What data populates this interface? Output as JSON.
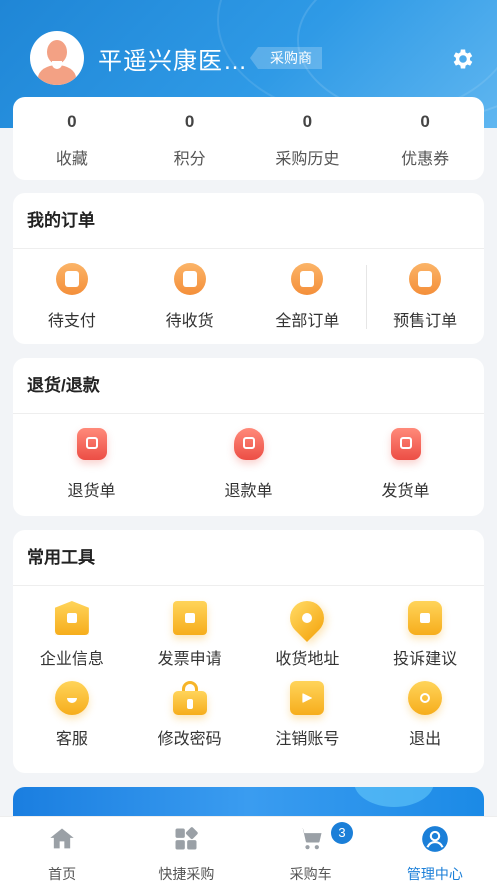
{
  "header": {
    "username": "平遥兴康医…",
    "role": "采购商"
  },
  "stats": [
    {
      "value": "0",
      "label": "收藏"
    },
    {
      "value": "0",
      "label": "积分"
    },
    {
      "value": "0",
      "label": "采购历史"
    },
    {
      "value": "0",
      "label": "优惠券"
    }
  ],
  "orders": {
    "title": "我的订单",
    "items": [
      {
        "label": "待支付",
        "icon": "wallet-icon"
      },
      {
        "label": "待收货",
        "icon": "package-icon"
      },
      {
        "label": "全部订单",
        "icon": "document-icon"
      },
      {
        "label": "预售订单",
        "icon": "calendar-clock-icon"
      }
    ]
  },
  "refunds": {
    "title": "退货/退款",
    "items": [
      {
        "label": "退货单",
        "icon": "return-icon"
      },
      {
        "label": "退款单",
        "icon": "money-bag-icon"
      },
      {
        "label": "发货单",
        "icon": "clipboard-edit-icon"
      }
    ]
  },
  "tools": {
    "title": "常用工具",
    "items": [
      {
        "label": "企业信息",
        "icon": "store-icon"
      },
      {
        "label": "发票申请",
        "icon": "receipt-icon"
      },
      {
        "label": "收货地址",
        "icon": "location-pin-icon"
      },
      {
        "label": "投诉建议",
        "icon": "chat-bubble-icon"
      },
      {
        "label": "客服",
        "icon": "smile-chat-icon"
      },
      {
        "label": "修改密码",
        "icon": "lock-icon"
      },
      {
        "label": "注销账号",
        "icon": "exit-door-icon"
      },
      {
        "label": "退出",
        "icon": "power-icon"
      }
    ]
  },
  "tabbar": {
    "items": [
      {
        "label": "首页",
        "icon": "home-icon"
      },
      {
        "label": "快捷采购",
        "icon": "grid-icon"
      },
      {
        "label": "采购车",
        "icon": "cart-icon"
      },
      {
        "label": "管理中心",
        "icon": "user-circle-icon"
      }
    ],
    "cart_count": "3",
    "active_index": 3
  },
  "colors": {
    "accent": "#1b7fd8",
    "order_icon": "#f48f3a",
    "refund_icon": "#ec4e45",
    "tool_icon": "#f6ad1c"
  }
}
